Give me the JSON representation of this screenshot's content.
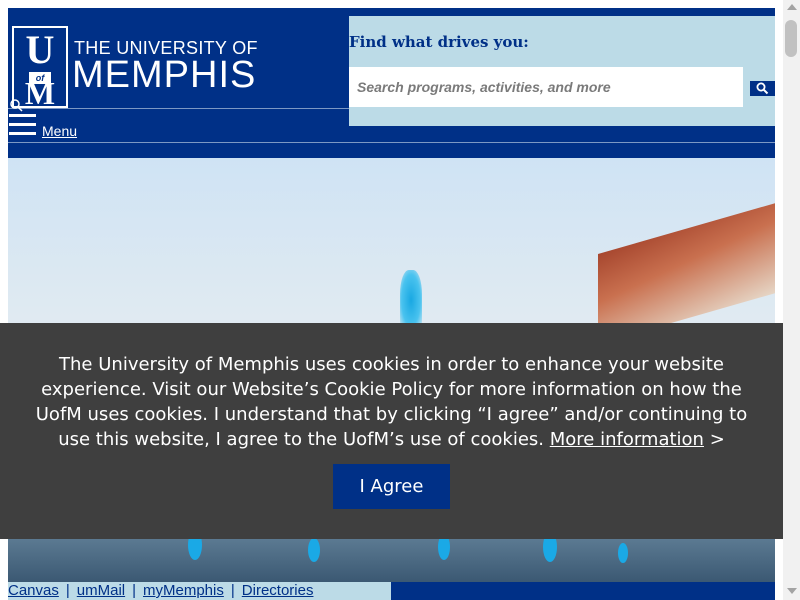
{
  "header": {
    "logo": {
      "letters": "U of M"
    },
    "wordmark_line1": "THE UNIVERSITY OF",
    "wordmark_line2": "MEMPHIS",
    "search_label": "Find what drives you:",
    "search_placeholder": "Search programs, activities, and more",
    "menu_label": "Menu"
  },
  "cookie_banner": {
    "message": "The University of Memphis uses cookies in order to enhance your website experience. Visit our Website’s Cookie Policy for more information on how the UofM uses cookies. I understand that by clicking “I agree” and/or continuing to use this website, I agree to the UofM’s use of cookies.",
    "more_info_link": "More information",
    "more_info_suffix": ">",
    "agree_button": "I Agree"
  },
  "footer": {
    "links": [
      "Canvas",
      "umMail",
      "myMemphis",
      "Directories"
    ],
    "separator": "|"
  },
  "colors": {
    "brand_blue": "#003087",
    "light_blue": "#bcdbe7",
    "cookie_bg": "#3f3f3f"
  },
  "icons": [
    "search-icon",
    "menu-icon"
  ]
}
